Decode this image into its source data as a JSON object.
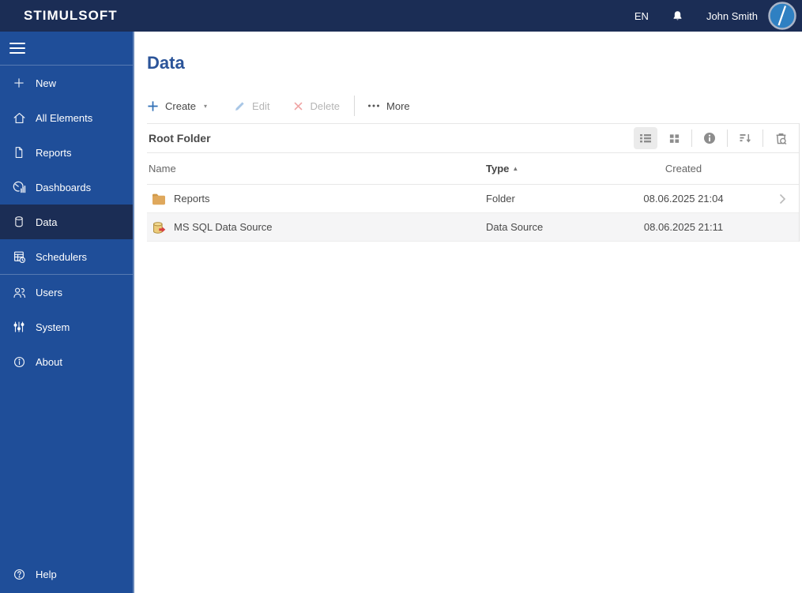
{
  "topbar": {
    "logo": "STIMULSOFT",
    "language": "EN",
    "user_name": "John Smith"
  },
  "sidebar": {
    "items": [
      {
        "label": "New",
        "icon": "plus-icon"
      },
      {
        "label": "All Elements",
        "icon": "home-icon"
      },
      {
        "label": "Reports",
        "icon": "document-icon"
      },
      {
        "label": "Dashboards",
        "icon": "gauge-icon"
      },
      {
        "label": "Data",
        "icon": "database-icon",
        "selected": true
      },
      {
        "label": "Schedulers",
        "icon": "scheduler-icon"
      },
      {
        "label": "Users",
        "icon": "users-icon"
      },
      {
        "label": "System",
        "icon": "sliders-icon"
      },
      {
        "label": "About",
        "icon": "info-icon"
      }
    ],
    "help_label": "Help"
  },
  "page": {
    "title": "Data"
  },
  "toolbar": {
    "create_label": "Create",
    "edit_label": "Edit",
    "delete_label": "Delete",
    "more_label": "More",
    "edit_enabled": false,
    "delete_enabled": false
  },
  "folder_bar": {
    "title": "Root Folder",
    "view_buttons": [
      "list-view",
      "grid-view",
      "info",
      "sort",
      "search-deleted"
    ],
    "selected_view": "list-view"
  },
  "table": {
    "headers": {
      "name": "Name",
      "type": "Type",
      "created": "Created"
    },
    "sorted_by": "Type",
    "sort_direction": "asc",
    "rows": [
      {
        "icon": "folder-icon",
        "name": "Reports",
        "type": "Folder",
        "created": "08.06.2025 21:04"
      },
      {
        "icon": "data-source-icon",
        "name": "MS SQL Data Source",
        "type": "Data Source",
        "created": "08.06.2025 21:11"
      }
    ]
  },
  "colors": {
    "topbar_bg": "#1b2d55",
    "sidebar_bg": "#1f4e99",
    "selected_item_bg": "#1b2d55",
    "title_blue": "#2b5499",
    "accent_blue": "#2f6fb5",
    "disabled_pencil": "#a8c6e6",
    "disabled_delete": "#efa3a3",
    "row_alt_bg": "#f5f5f6",
    "folder_icon": "#dfa85c",
    "datasource_icon": "#eccc7b",
    "datasource_arrow": "#d84040",
    "avatar_fill": "#2f80c2"
  }
}
